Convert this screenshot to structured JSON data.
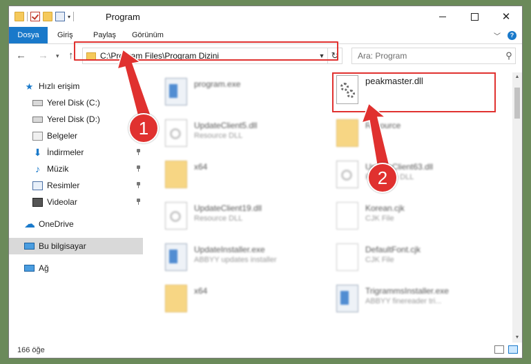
{
  "window": {
    "title": "Program"
  },
  "ribbon": {
    "tabs": [
      "Dosya",
      "Giriş",
      "Paylaş",
      "Görünüm"
    ]
  },
  "address": {
    "path": "C:\\Program Files\\Program Dizini"
  },
  "search": {
    "placeholder": "Ara: Program"
  },
  "sidebar": {
    "items": [
      {
        "label": "Hızlı erişim",
        "icon": "star-icon"
      },
      {
        "label": "Yerel Disk (C:)",
        "icon": "drive-icon"
      },
      {
        "label": "Yerel Disk (D:)",
        "icon": "drive-icon"
      },
      {
        "label": "Belgeler",
        "icon": "documents-icon"
      },
      {
        "label": "İndirmeler",
        "icon": "download-icon"
      },
      {
        "label": "Müzik",
        "icon": "music-icon"
      },
      {
        "label": "Resimler",
        "icon": "pictures-icon"
      },
      {
        "label": "Videolar",
        "icon": "video-icon"
      },
      {
        "label": "OneDrive",
        "icon": "cloud-icon"
      },
      {
        "label": "Bu bilgisayar",
        "icon": "computer-icon"
      },
      {
        "label": "Ağ",
        "icon": "network-icon"
      }
    ]
  },
  "files": [
    {
      "name": "program.exe",
      "type": "",
      "icon": "installer-icon"
    },
    {
      "name": "peakmaster.dll",
      "type": "",
      "icon": "dll-gear-icon"
    },
    {
      "name": "UpdateClient5.dll",
      "type": "Resource DLL",
      "icon": "dll-icon"
    },
    {
      "name": "Resource",
      "type": "",
      "icon": "folder-icon"
    },
    {
      "name": "x64",
      "type": "",
      "icon": "folder-icon"
    },
    {
      "name": "UpdateClient63.dll",
      "type": "Resource DLL",
      "icon": "dll-icon"
    },
    {
      "name": "UpdateClient19.dll",
      "type": "Resource DLL",
      "icon": "dll-icon"
    },
    {
      "name": "Korean.cjk",
      "type": "CJK File",
      "icon": "file-icon"
    },
    {
      "name": "UpdateInstaller.exe",
      "type": "ABBYY updates installer",
      "icon": "exe-icon"
    },
    {
      "name": "DefaultFont.cjk",
      "type": "CJK File",
      "icon": "file-icon"
    },
    {
      "name": "x64",
      "type": "",
      "icon": "folder-icon"
    },
    {
      "name": "TrigrammsInstaller.exe",
      "type": "ABBYY finereader tri...",
      "icon": "exe-icon"
    }
  ],
  "status": {
    "count": "166 öğe"
  },
  "annotations": {
    "one": "1",
    "two": "2"
  },
  "colors": {
    "accent": "#1979ca",
    "highlight": "#e0312f",
    "selected": "#cce8ff"
  }
}
